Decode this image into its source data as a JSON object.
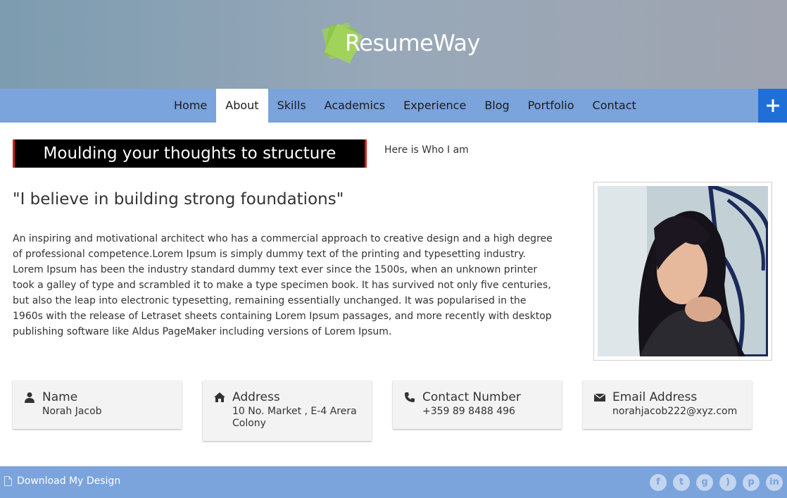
{
  "header": {
    "logo_text": "ResumeWay"
  },
  "nav": {
    "items": [
      {
        "label": "Home"
      },
      {
        "label": "About"
      },
      {
        "label": "Skills"
      },
      {
        "label": "Academics"
      },
      {
        "label": "Experience"
      },
      {
        "label": "Blog"
      },
      {
        "label": "Portfolio"
      },
      {
        "label": "Contact"
      }
    ],
    "active": "About",
    "plus_icon": "plus-icon"
  },
  "about": {
    "banner": "Moulding your thoughts to structure",
    "tagline": "Here is Who I am",
    "quote": "\"I believe in building strong foundations\"",
    "bio": "An inspiring and motivational architect who has a commercial approach to creative design and a high degree of professional competence.Lorem Ipsum is simply dummy text of the printing and typesetting industry. Lorem Ipsum has been the industry standard dummy text ever since the 1500s, when an unknown printer took a galley of type and scrambled it to make a type specimen book. It has survived not only five centuries, but also the leap into electronic typesetting, remaining essentially unchanged. It was popularised in the 1960s with the release of Letraset sheets containing Lorem Ipsum passages, and more recently with desktop publishing software like Aldus PageMaker including versions of Lorem Ipsum."
  },
  "info": [
    {
      "icon": "user-icon",
      "title": "Name",
      "value": "Norah Jacob"
    },
    {
      "icon": "home-icon",
      "title": "Address",
      "value": "10 No. Market , E-4 Arera Colony"
    },
    {
      "icon": "phone-icon",
      "title": "Contact Number",
      "value": "+359 89 8488 496"
    },
    {
      "icon": "envelope-icon",
      "title": "Email Address",
      "value": "norahjacob222@xyz.com"
    }
  ],
  "footer": {
    "download_label": "Download My Design",
    "socials": [
      "facebook-icon",
      "twitter-icon",
      "google-plus-icon",
      "rss-icon",
      "pinterest-icon",
      "linkedin-icon"
    ]
  },
  "colors": {
    "nav_bg": "#7ba3dc",
    "accent_blue": "#1f6fd6",
    "banner_border": "#d41f1f",
    "logo_green": "#8cc63f"
  }
}
